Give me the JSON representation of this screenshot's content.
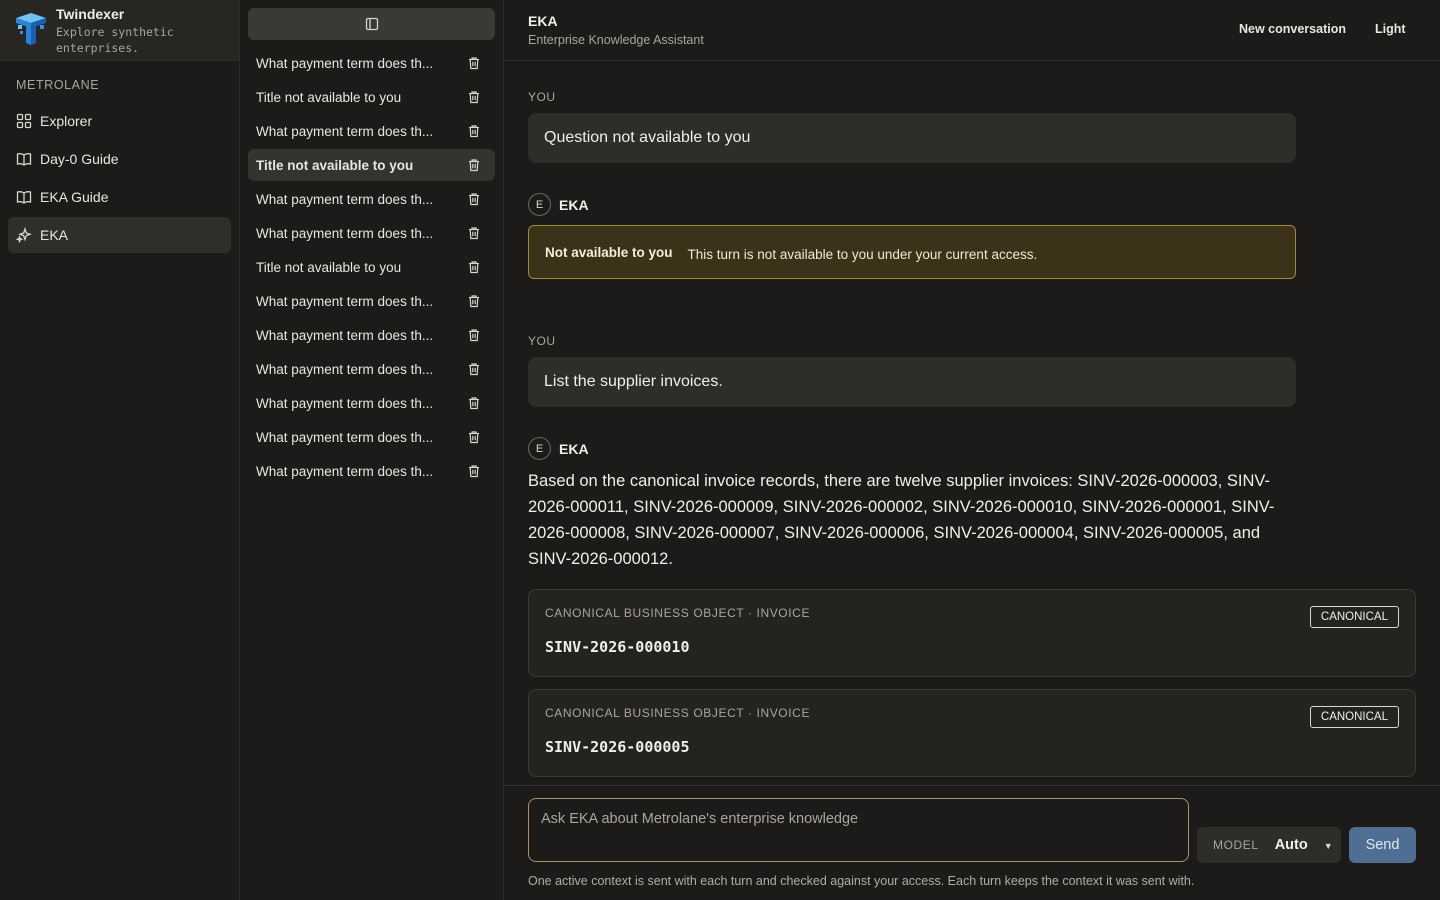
{
  "brand": {
    "name": "Twindexer",
    "tagline_line1": "Explore synthetic",
    "tagline_line2": "enterprises."
  },
  "org_name": "METROLANE",
  "nav": [
    {
      "label": "Explorer",
      "icon": "grid-icon"
    },
    {
      "label": "Day-0 Guide",
      "icon": "book-icon"
    },
    {
      "label": "EKA Guide",
      "icon": "book-icon"
    },
    {
      "label": "EKA",
      "icon": "sparkle-icon",
      "active": true
    }
  ],
  "conversations": [
    {
      "title": "What payment term does th..."
    },
    {
      "title": "Title not available to you"
    },
    {
      "title": "What payment term does th..."
    },
    {
      "title": "Title not available to you",
      "active": true
    },
    {
      "title": "What payment term does th..."
    },
    {
      "title": "What payment term does th..."
    },
    {
      "title": "Title not available to you"
    },
    {
      "title": "What payment term does th..."
    },
    {
      "title": "What payment term does th..."
    },
    {
      "title": "What payment term does th..."
    },
    {
      "title": "What payment term does th..."
    },
    {
      "title": "What payment term does th..."
    },
    {
      "title": "What payment term does th..."
    }
  ],
  "header": {
    "title": "EKA",
    "subtitle": "Enterprise Knowledge Assistant",
    "new_conversation": "New conversation",
    "theme": "Light"
  },
  "messages": {
    "you_label": "YOU",
    "eka_label": "EKA",
    "eka_avatar": "E",
    "q1": "Question not available to you",
    "notice_label": "Not available to you",
    "notice_text": "This turn is not available to you under your current access.",
    "q2": "List the supplier invoices.",
    "a2": "Based on the canonical invoice records, there are twelve supplier invoices: SINV-2026-000003, SINV-2026-000011, SINV-2026-000009, SINV-2026-000002, SINV-2026-000010, SINV-2026-000001, SINV-2026-000008, SINV-2026-000007, SINV-2026-000006, SINV-2026-000004, SINV-2026-000005, and SINV-2026-000012."
  },
  "cards": [
    {
      "kicker": "CANONICAL BUSINESS OBJECT · INVOICE",
      "id": "SINV-2026-000010",
      "badge": "CANONICAL"
    },
    {
      "kicker": "CANONICAL BUSINESS OBJECT · INVOICE",
      "id": "SINV-2026-000005",
      "badge": "CANONICAL"
    }
  ],
  "composer": {
    "placeholder": "Ask EKA about Metrolane's enterprise knowledge",
    "value": "",
    "model_label": "MODEL",
    "model_value": "Auto",
    "send": "Send",
    "note": "One active context is sent with each turn and checked against your access. Each turn keeps the context it was sent with."
  },
  "colors": {
    "accent": "#4e6f93",
    "notice_border": "#a88a2e",
    "notice_bg": "#3a3219"
  }
}
